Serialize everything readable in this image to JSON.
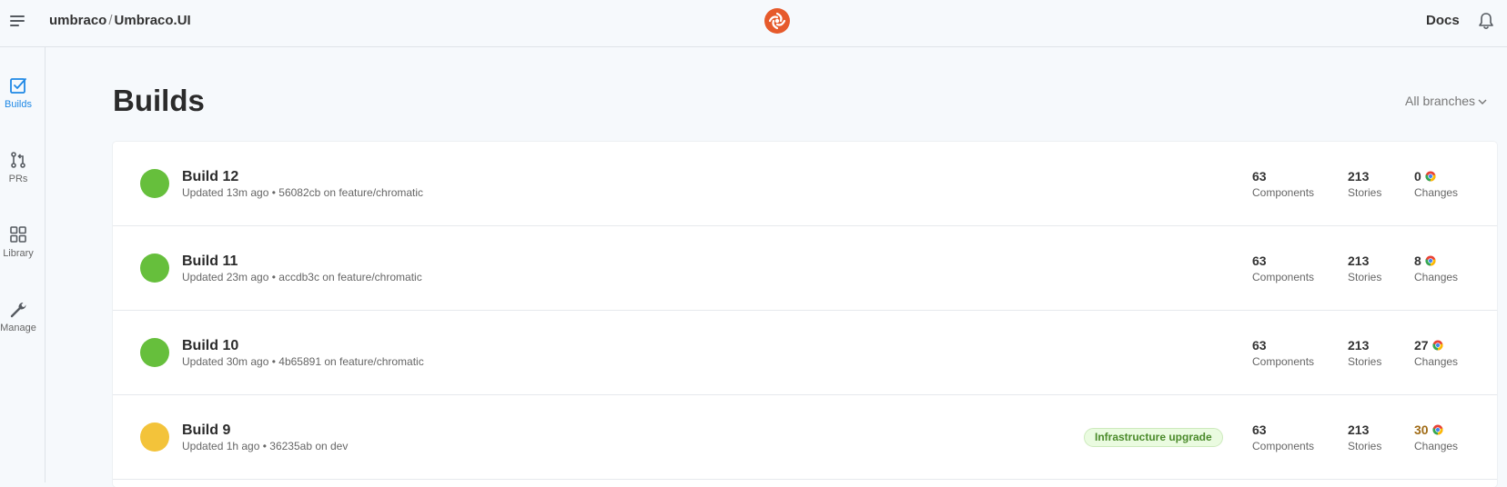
{
  "header": {
    "org": "umbraco",
    "separator": "/",
    "project": "Umbraco.UI",
    "docs_label": "Docs"
  },
  "sidebar": {
    "items": [
      {
        "label": "Builds",
        "icon": "checkbox-icon",
        "active": true
      },
      {
        "label": "PRs",
        "icon": "pull-request-icon",
        "active": false
      },
      {
        "label": "Library",
        "icon": "grid-icon",
        "active": false
      },
      {
        "label": "Manage",
        "icon": "wrench-icon",
        "active": false
      }
    ]
  },
  "main": {
    "title": "Builds",
    "branch_filter": "All branches"
  },
  "builds": [
    {
      "name": "Build 12",
      "meta": "Updated 13m ago • 56082cb on feature/chromatic",
      "status_color": "#66bf3c",
      "tag": "",
      "components": "63",
      "components_label": "Components",
      "stories": "213",
      "stories_label": "Stories",
      "changes": "0",
      "changes_label": "Changes"
    },
    {
      "name": "Build 11",
      "meta": "Updated 23m ago • accdb3c on feature/chromatic",
      "status_color": "#66bf3c",
      "tag": "",
      "components": "63",
      "components_label": "Components",
      "stories": "213",
      "stories_label": "Stories",
      "changes": "8",
      "changes_label": "Changes"
    },
    {
      "name": "Build 10",
      "meta": "Updated 30m ago • 4b65891 on feature/chromatic",
      "status_color": "#66bf3c",
      "tag": "",
      "components": "63",
      "components_label": "Components",
      "stories": "213",
      "stories_label": "Stories",
      "changes": "27",
      "changes_label": "Changes"
    },
    {
      "name": "Build 9",
      "meta": "Updated 1h ago • 36235ab on dev",
      "status_color": "#f3c33a",
      "tag": "Infrastructure upgrade",
      "components": "63",
      "components_label": "Components",
      "stories": "213",
      "stories_label": "Stories",
      "changes": "30",
      "changes_label": "Changes"
    }
  ],
  "colors": {
    "accent": "#1e88e5",
    "success": "#66bf3c",
    "pending": "#f3c33a",
    "logo": "#e65a2b"
  }
}
